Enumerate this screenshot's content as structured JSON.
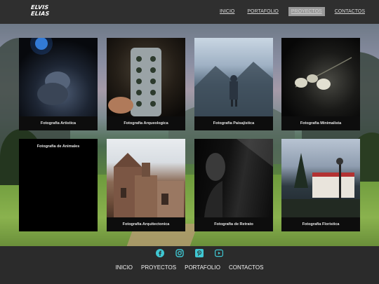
{
  "brand": {
    "line1": "ELVIS",
    "line2": "ELIAS"
  },
  "nav": {
    "items": [
      {
        "label": "INICIO"
      },
      {
        "label": "PORTAFOLIO"
      },
      {
        "label": "PROYECTOS",
        "active": true
      },
      {
        "label": "CONTACTOS"
      }
    ]
  },
  "gallery": {
    "cards": [
      {
        "caption": "Fotografia Artistica"
      },
      {
        "caption": "Fotografia Arqueologica"
      },
      {
        "caption": "Fotografia Paisajistica"
      },
      {
        "caption": "Fotografia Minimalista"
      },
      {
        "caption": "Fotografia de Animales"
      },
      {
        "caption": "Fotografia Arquitectonica"
      },
      {
        "caption": "Fotografia de Retrato"
      },
      {
        "caption": "Fotografia Floristica"
      }
    ]
  },
  "footer": {
    "social_icons": [
      "facebook-icon",
      "instagram-icon",
      "pinterest-icon",
      "youtube-icon"
    ],
    "nav": [
      {
        "label": "INICIO"
      },
      {
        "label": "PROYECTOS"
      },
      {
        "label": "PORTAFOLIO"
      },
      {
        "label": "CONTACTOS"
      }
    ]
  },
  "colors": {
    "accent": "#3fc7d2",
    "bar": "#2f2f2f",
    "active_nav": "#9a9a9a"
  }
}
